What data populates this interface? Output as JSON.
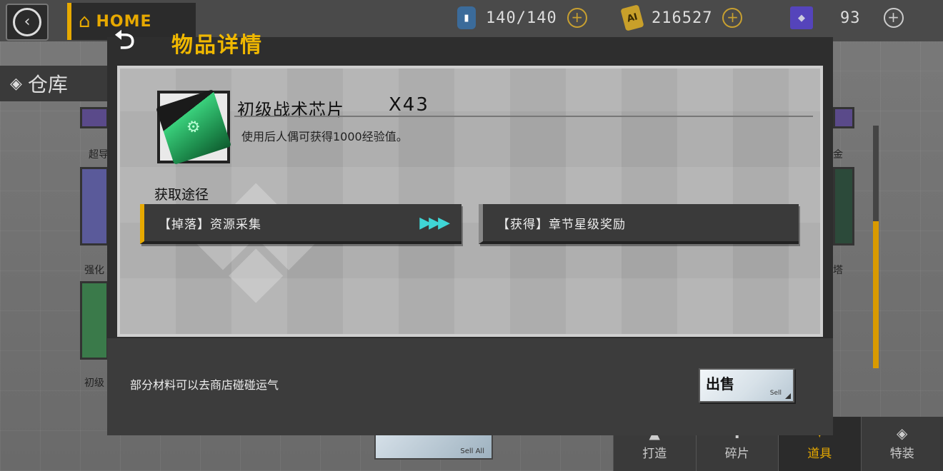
{
  "topbar": {
    "home_label": "HOME",
    "resources": [
      {
        "icon": "battery-icon",
        "value": "140/140"
      },
      {
        "icon": "ai-coin-icon",
        "value": "216527"
      },
      {
        "icon": "crystal-icon",
        "value": "93"
      }
    ]
  },
  "page": {
    "title": "仓库",
    "bg_labels": [
      "超导",
      "强化",
      "初级",
      "金",
      "塔"
    ],
    "sell_all_label": "Sell All",
    "tabs": [
      {
        "label": "打造",
        "icon": "forge-icon"
      },
      {
        "label": "碎片",
        "icon": "fragment-icon"
      },
      {
        "label": "道具",
        "icon": "item-icon",
        "active": true
      },
      {
        "label": "特装",
        "icon": "special-icon"
      }
    ]
  },
  "modal": {
    "title": "物品详情",
    "item": {
      "name": "初级战术芯片",
      "quantity": "X43",
      "description": "使用后人偶可获得1000经验值。",
      "icon": "tactical-chip-icon"
    },
    "sources_heading": "获取途径",
    "sources": [
      {
        "label": "【掉落】资源采集",
        "has_arrow": true
      },
      {
        "label": "【获得】章节星级奖励",
        "has_arrow": false
      }
    ],
    "hint": "部分材料可以去商店碰碰运气",
    "sell": {
      "label": "出售",
      "sub_label": "Sell"
    }
  }
}
